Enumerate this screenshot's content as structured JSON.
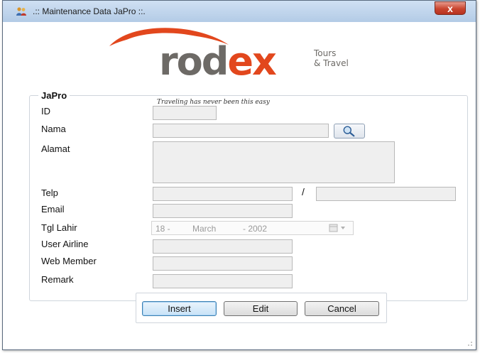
{
  "window": {
    "title": ".:: Maintenance Data JaPro ::.",
    "close_glyph": "x",
    "icon": "people-icon"
  },
  "logo": {
    "brand": "rodex",
    "tours": "Tours",
    "travel": "& Travel",
    "tagline": "Traveling has never been this easy"
  },
  "form": {
    "group_title": "JaPro",
    "labels": {
      "id": "ID",
      "nama": "Nama",
      "alamat": "Alamat",
      "telp": "Telp",
      "email": "Email",
      "tgl_lahir": "Tgl Lahir",
      "user_airline": "User Airline",
      "web_member": "Web Member",
      "remark": "Remark"
    },
    "telp_separator": "/",
    "search_icon": "magnifier-icon",
    "tgl_lahir": {
      "day": "18 -",
      "month": "March",
      "year": "- 2002"
    }
  },
  "buttons": {
    "insert": "Insert",
    "edit": "Edit",
    "cancel": "Cancel"
  },
  "colors": {
    "brand_gray": "#6d6a66",
    "brand_red": "#e2471d"
  }
}
